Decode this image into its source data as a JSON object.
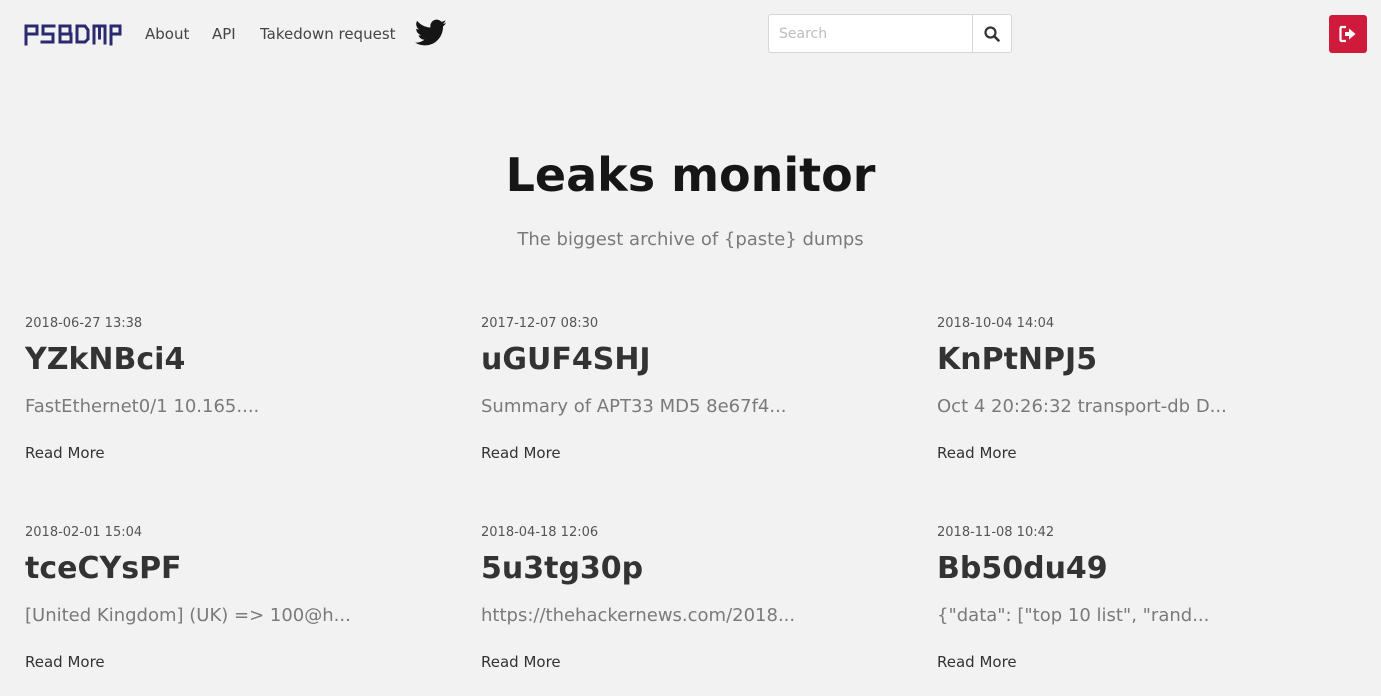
{
  "nav": {
    "logo_text": "PSBDMP",
    "links": [
      "About",
      "API",
      "Takedown request"
    ],
    "twitter_icon": "twitter-icon",
    "search_placeholder": "Search",
    "search_icon": "search-icon",
    "logout_icon": "sign-out-icon",
    "logout_color": "#d01a3c",
    "logo_color": "#2b2a6e"
  },
  "hero": {
    "title": "Leaks monitor",
    "subtitle": "The biggest archive of {paste} dumps"
  },
  "cards": [
    {
      "date": "2018-06-27 13:38",
      "title": "YZkNBci4",
      "excerpt": "FastEthernet0/1 10.165....",
      "link": "Read More"
    },
    {
      "date": "2017-12-07 08:30",
      "title": "uGUF4SHJ",
      "excerpt": "Summary of APT33 MD5 8e67f4...",
      "link": "Read More"
    },
    {
      "date": "2018-10-04 14:04",
      "title": "KnPtNPJ5",
      "excerpt": "Oct 4 20:26:32 transport-db D...",
      "link": "Read More"
    },
    {
      "date": "2018-02-01 15:04",
      "title": "tceCYsPF",
      "excerpt": "[United Kingdom] (UK) => 100@h...",
      "link": "Read More"
    },
    {
      "date": "2018-04-18 12:06",
      "title": "5u3tg30p",
      "excerpt": "https://thehackernews.com/2018...",
      "link": "Read More"
    },
    {
      "date": "2018-11-08 10:42",
      "title": "Bb50du49",
      "excerpt": "{\"data\": [\"top 10 list\", \"rand...",
      "link": "Read More"
    }
  ]
}
